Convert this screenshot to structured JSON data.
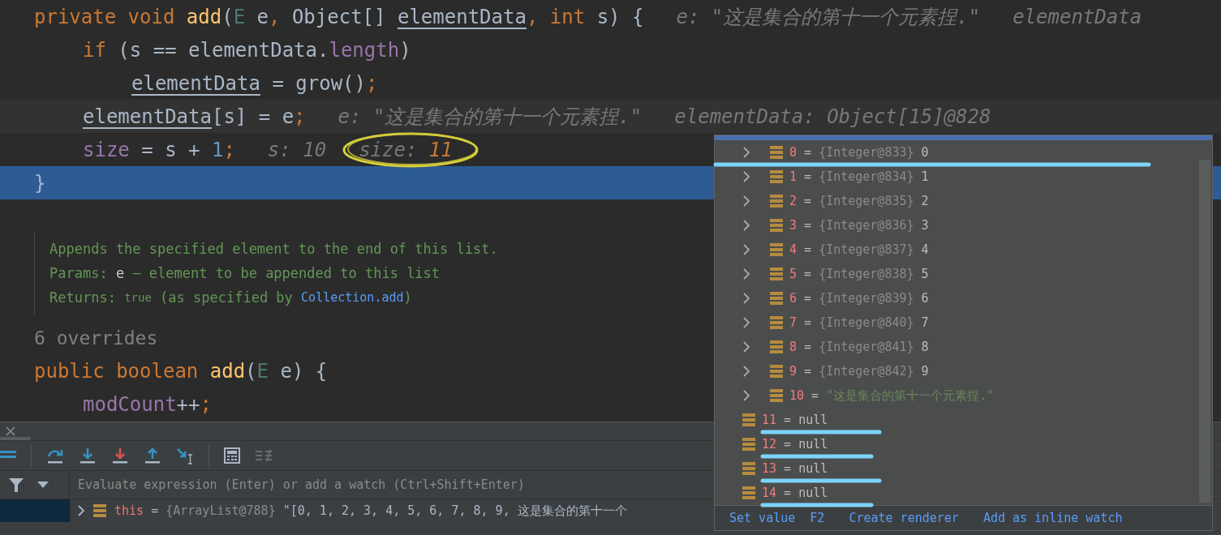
{
  "editor": {
    "lines": [
      {
        "kind": "normal",
        "tokens": [
          {
            "kind": "keyword",
            "text": "private void "
          },
          {
            "kind": "method",
            "text": "add"
          },
          {
            "kind": "plain",
            "text": "("
          },
          {
            "kind": "typeparam",
            "text": "E"
          },
          {
            "kind": "plain",
            "text": " e"
          },
          {
            "kind": "punct",
            "text": ", "
          },
          {
            "kind": "plain",
            "text": "Object[] "
          },
          {
            "kind": "reassigned",
            "text": "elementData"
          },
          {
            "kind": "punct",
            "text": ", "
          },
          {
            "kind": "keyword",
            "text": "int"
          },
          {
            "kind": "plain",
            "text": " s) {"
          }
        ],
        "hints": [
          {
            "label": "e:",
            "value": "\"这是集合的第十一个元素捏.\"",
            "changed": false,
            "circled": false
          },
          {
            "label": "elementData"
          }
        ],
        "children": [
          {
            "kind": "normal",
            "tokens": [
              {
                "kind": "keyword",
                "text": "if"
              },
              {
                "kind": "plain",
                "text": " (s == elementData."
              },
              {
                "kind": "field",
                "text": "length"
              },
              {
                "kind": "plain",
                "text": ")"
              }
            ],
            "children": [
              {
                "kind": "normal",
                "tokens": [
                  {
                    "kind": "reassigned",
                    "text": "elementData"
                  },
                  {
                    "kind": "plain",
                    "text": " = grow()"
                  },
                  {
                    "kind": "punct",
                    "text": ";"
                  }
                ]
              }
            ]
          },
          {
            "kind": "caret",
            "tokens": [
              {
                "kind": "reassigned",
                "text": "elementData"
              },
              {
                "kind": "plain",
                "text": "[s] = e"
              },
              {
                "kind": "punct",
                "text": ";"
              }
            ],
            "hints": [
              {
                "label": "e:",
                "value": "\"这是集合的第十一个元素捏.\"",
                "changed": false,
                "circled": false
              },
              {
                "label": "elementData:",
                "value": "Object[15]@828",
                "changed": false,
                "circled": false
              }
            ]
          },
          {
            "kind": "normal",
            "tokens": [
              {
                "kind": "field",
                "text": "size"
              },
              {
                "kind": "plain",
                "text": " = s + "
              },
              {
                "kind": "number",
                "text": "1"
              },
              {
                "kind": "punct",
                "text": ";"
              }
            ],
            "hints": [
              {
                "label": "s:",
                "value": "10",
                "changed": false,
                "circled": false
              },
              {
                "label": "size:",
                "value": "11",
                "changed": true,
                "circled": true
              }
            ]
          }
        ]
      },
      {
        "kind": "execution",
        "tokens": [
          {
            "kind": "plain",
            "text": "}"
          }
        ]
      }
    ],
    "doc": [
      [
        {
          "kind": "text",
          "text": "Appends the specified element to the end of this list."
        }
      ],
      [
        {
          "kind": "label",
          "text": "Params: "
        },
        {
          "kind": "param",
          "text": "e"
        },
        {
          "kind": "text",
          "text": " – element to be appended to this list"
        }
      ],
      [
        {
          "kind": "label",
          "text": "Returns: "
        },
        {
          "kind": "code",
          "text": "true"
        },
        {
          "kind": "text",
          "text": " (as specified by "
        },
        {
          "kind": "link",
          "text": "Collection.add"
        },
        {
          "kind": "text",
          "text": ")"
        }
      ]
    ],
    "overrides": "6 overrides",
    "lines_after": [
      {
        "kind": "normal",
        "tokens": [
          {
            "kind": "keyword",
            "text": "public boolean "
          },
          {
            "kind": "method",
            "text": "add"
          },
          {
            "kind": "plain",
            "text": "("
          },
          {
            "kind": "typeparam",
            "text": "E"
          },
          {
            "kind": "plain",
            "text": " e) {"
          }
        ],
        "children": [
          {
            "kind": "normal",
            "tokens": [
              {
                "kind": "field",
                "text": "modCount"
              },
              {
                "kind": "plain",
                "text": "++"
              },
              {
                "kind": "punct",
                "text": ";"
              }
            ]
          }
        ]
      }
    ]
  },
  "debugger": {
    "watch_field": {
      "placeholder": "Evaluate expression (Enter) or add a watch (Ctrl+Shift+Enter)"
    },
    "variable": {
      "name": "this",
      "op": "=",
      "type": "{ArrayList@788}",
      "value": "\"[0, 1, 2, 3, 4, 5, 6, 7, 8, 9, 这是集合的第十一个"
    }
  },
  "popup": {
    "rows": [
      {
        "kind": "object",
        "index": "0",
        "op": "=",
        "type": "{Integer@833}",
        "value": "0",
        "expandable": true,
        "underlined": true
      },
      {
        "kind": "object",
        "index": "1",
        "op": "=",
        "type": "{Integer@834}",
        "value": "1",
        "expandable": true,
        "underlined": false
      },
      {
        "kind": "object",
        "index": "2",
        "op": "=",
        "type": "{Integer@835}",
        "value": "2",
        "expandable": true,
        "underlined": false
      },
      {
        "kind": "object",
        "index": "3",
        "op": "=",
        "type": "{Integer@836}",
        "value": "3",
        "expandable": true,
        "underlined": false
      },
      {
        "kind": "object",
        "index": "4",
        "op": "=",
        "type": "{Integer@837}",
        "value": "4",
        "expandable": true,
        "underlined": false
      },
      {
        "kind": "object",
        "index": "5",
        "op": "=",
        "type": "{Integer@838}",
        "value": "5",
        "expandable": true,
        "underlined": false
      },
      {
        "kind": "object",
        "index": "6",
        "op": "=",
        "type": "{Integer@839}",
        "value": "6",
        "expandable": true,
        "underlined": false
      },
      {
        "kind": "object",
        "index": "7",
        "op": "=",
        "type": "{Integer@840}",
        "value": "7",
        "expandable": true,
        "underlined": false
      },
      {
        "kind": "object",
        "index": "8",
        "op": "=",
        "type": "{Integer@841}",
        "value": "8",
        "expandable": true,
        "underlined": false
      },
      {
        "kind": "object",
        "index": "9",
        "op": "=",
        "type": "{Integer@842}",
        "value": "9",
        "expandable": true,
        "underlined": false
      },
      {
        "kind": "string",
        "index": "10",
        "op": "=",
        "value": "\"这是集合的第十一个元素捏.\"",
        "expandable": true,
        "underlined": false
      },
      {
        "kind": "null",
        "index": "11",
        "op": "=",
        "value": "null",
        "expandable": false,
        "underlined": true
      },
      {
        "kind": "null",
        "index": "12",
        "op": "=",
        "value": "null",
        "expandable": false,
        "underlined": true
      },
      {
        "kind": "null",
        "index": "13",
        "op": "=",
        "value": "null",
        "expandable": false,
        "underlined": true
      },
      {
        "kind": "null",
        "index": "14",
        "op": "=",
        "value": "null",
        "expandable": false,
        "underlined": true
      }
    ],
    "actions": [
      {
        "label": "Set value",
        "shortcut": "F2"
      },
      {
        "label": "Create renderer"
      },
      {
        "label": "Add as inline watch"
      }
    ]
  }
}
